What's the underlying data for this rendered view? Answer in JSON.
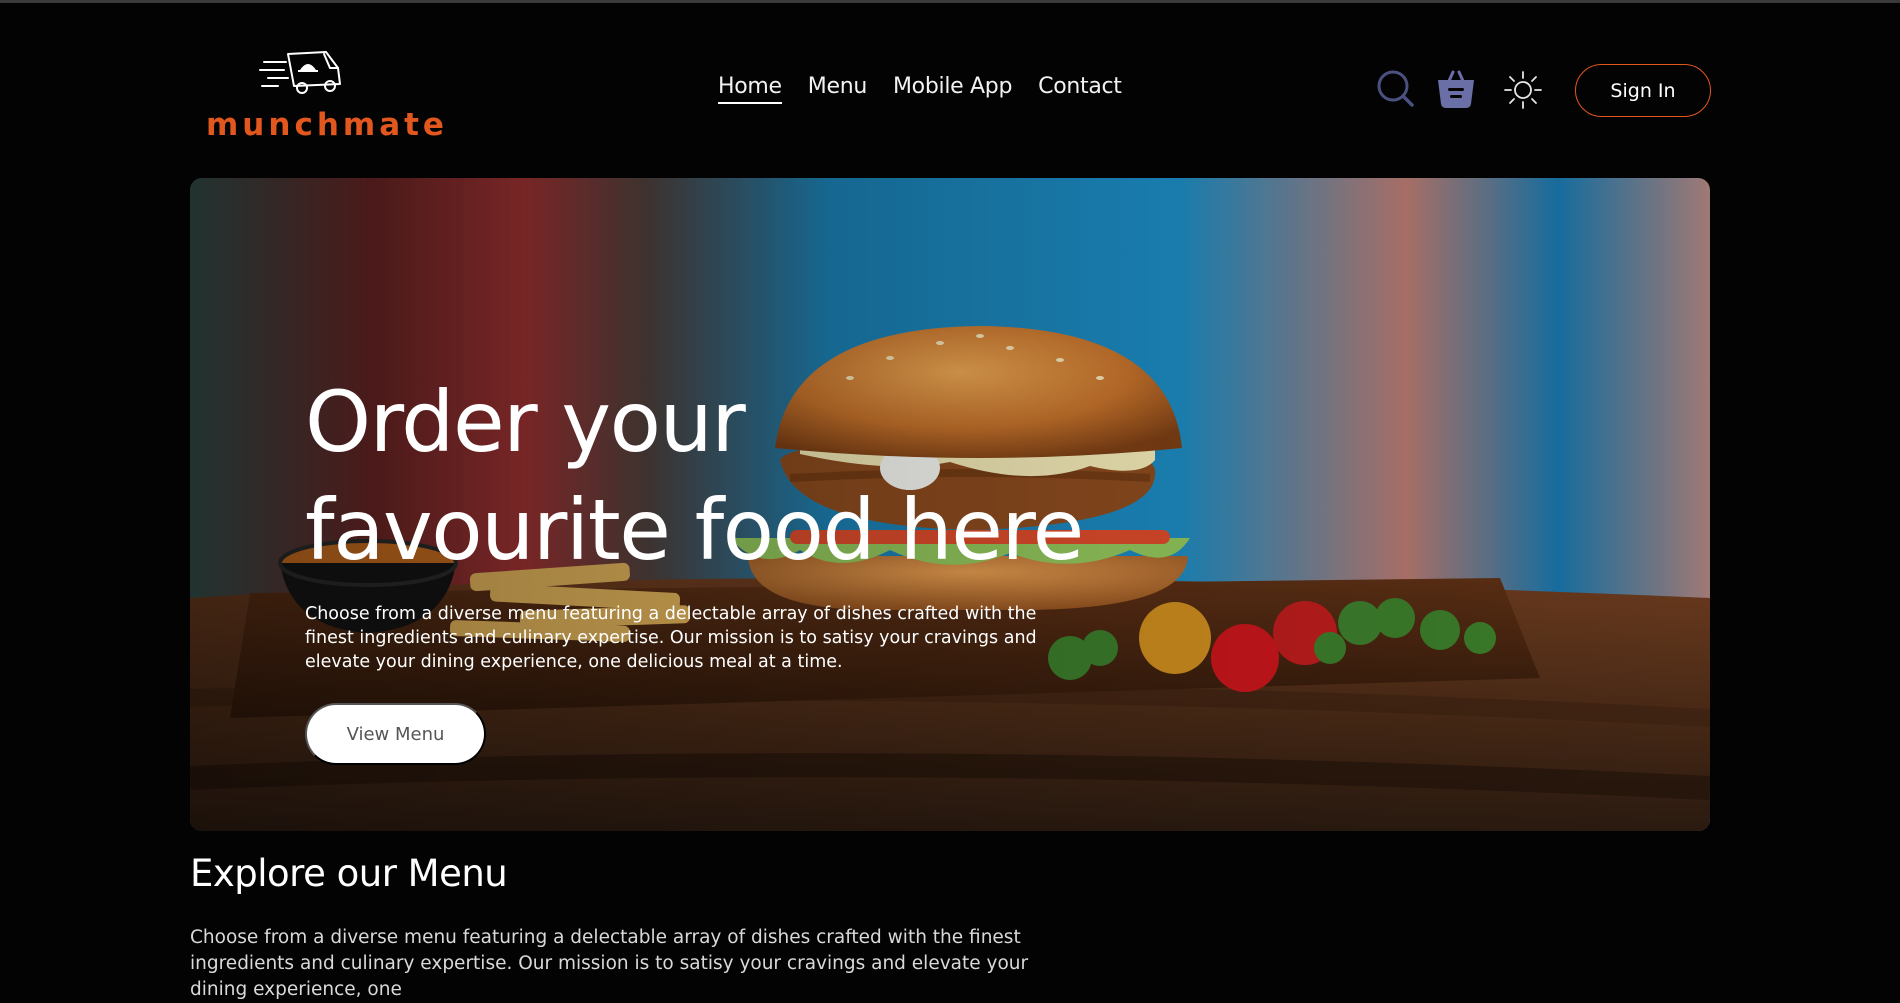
{
  "brand": {
    "name": "munchmate",
    "accent": "#e2571e"
  },
  "nav": {
    "items": [
      {
        "label": "Home",
        "active": true
      },
      {
        "label": "Menu",
        "active": false
      },
      {
        "label": "Mobile App",
        "active": false
      },
      {
        "label": "Contact",
        "active": false
      }
    ],
    "icons": [
      "search-icon",
      "basket-icon",
      "sun-icon"
    ],
    "sign_in_label": "Sign In"
  },
  "hero": {
    "title_line1": "Order your",
    "title_line2": "favourite food here",
    "description": "Choose from a diverse menu featuring a delectable array of dishes crafted with the finest ingredients and culinary expertise. Our mission is to satisy your cravings and elevate your dining experience, one delicious meal at a time.",
    "cta_label": "View Menu"
  },
  "explore": {
    "title": "Explore our Menu",
    "description": "Choose from a diverse menu featuring a delectable array of dishes crafted with the finest ingredients and culinary expertise. Our mission is to satisy your cravings and elevate your dining experience, one"
  },
  "colors": {
    "background": "#030303",
    "search_icon": "#4a5180",
    "basket_icon": "#6a6fa6",
    "sign_in_border": "#e2571e"
  }
}
